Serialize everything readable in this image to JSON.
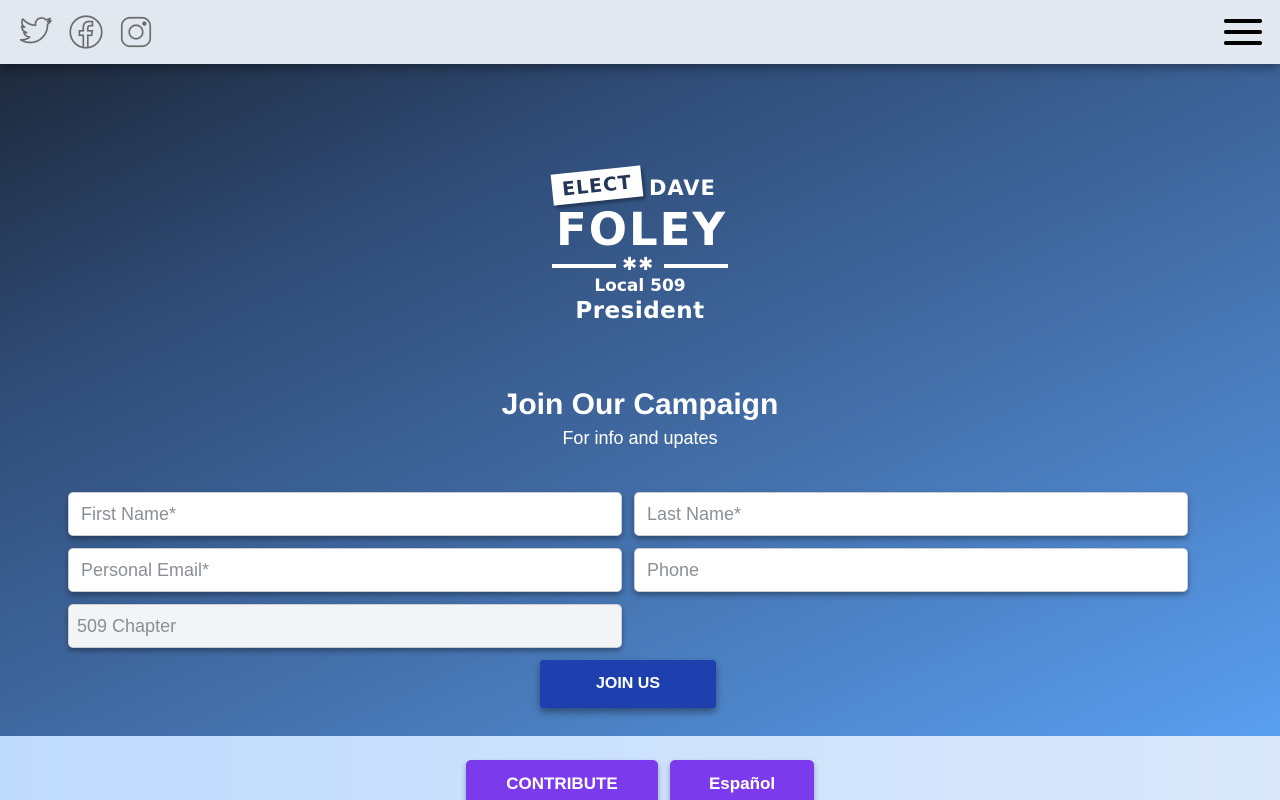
{
  "header": {
    "social_icons": [
      "twitter-icon",
      "facebook-icon",
      "instagram-icon"
    ],
    "menu_icon": "hamburger-menu-icon"
  },
  "logo": {
    "elect": "ELECT",
    "first_name": "DAVE",
    "last_name": "FOLEY",
    "stars": "✱✱",
    "local": "Local 509",
    "office": "President"
  },
  "form": {
    "title": "Join Our Campaign",
    "subtitle": "For info and upates",
    "first_name_placeholder": "First Name*",
    "last_name_placeholder": "Last Name*",
    "email_placeholder": "Personal Email*",
    "phone_placeholder": "Phone",
    "chapter_placeholder": "509 Chapter",
    "submit_label": "JOIN US"
  },
  "footer": {
    "contribute_label": "CONTRIBUTE",
    "espanol_label": "Español"
  },
  "colors": {
    "header_bg": "#e2e8f0",
    "join_button": "#1e40af",
    "pill_button": "#7c3aed"
  }
}
